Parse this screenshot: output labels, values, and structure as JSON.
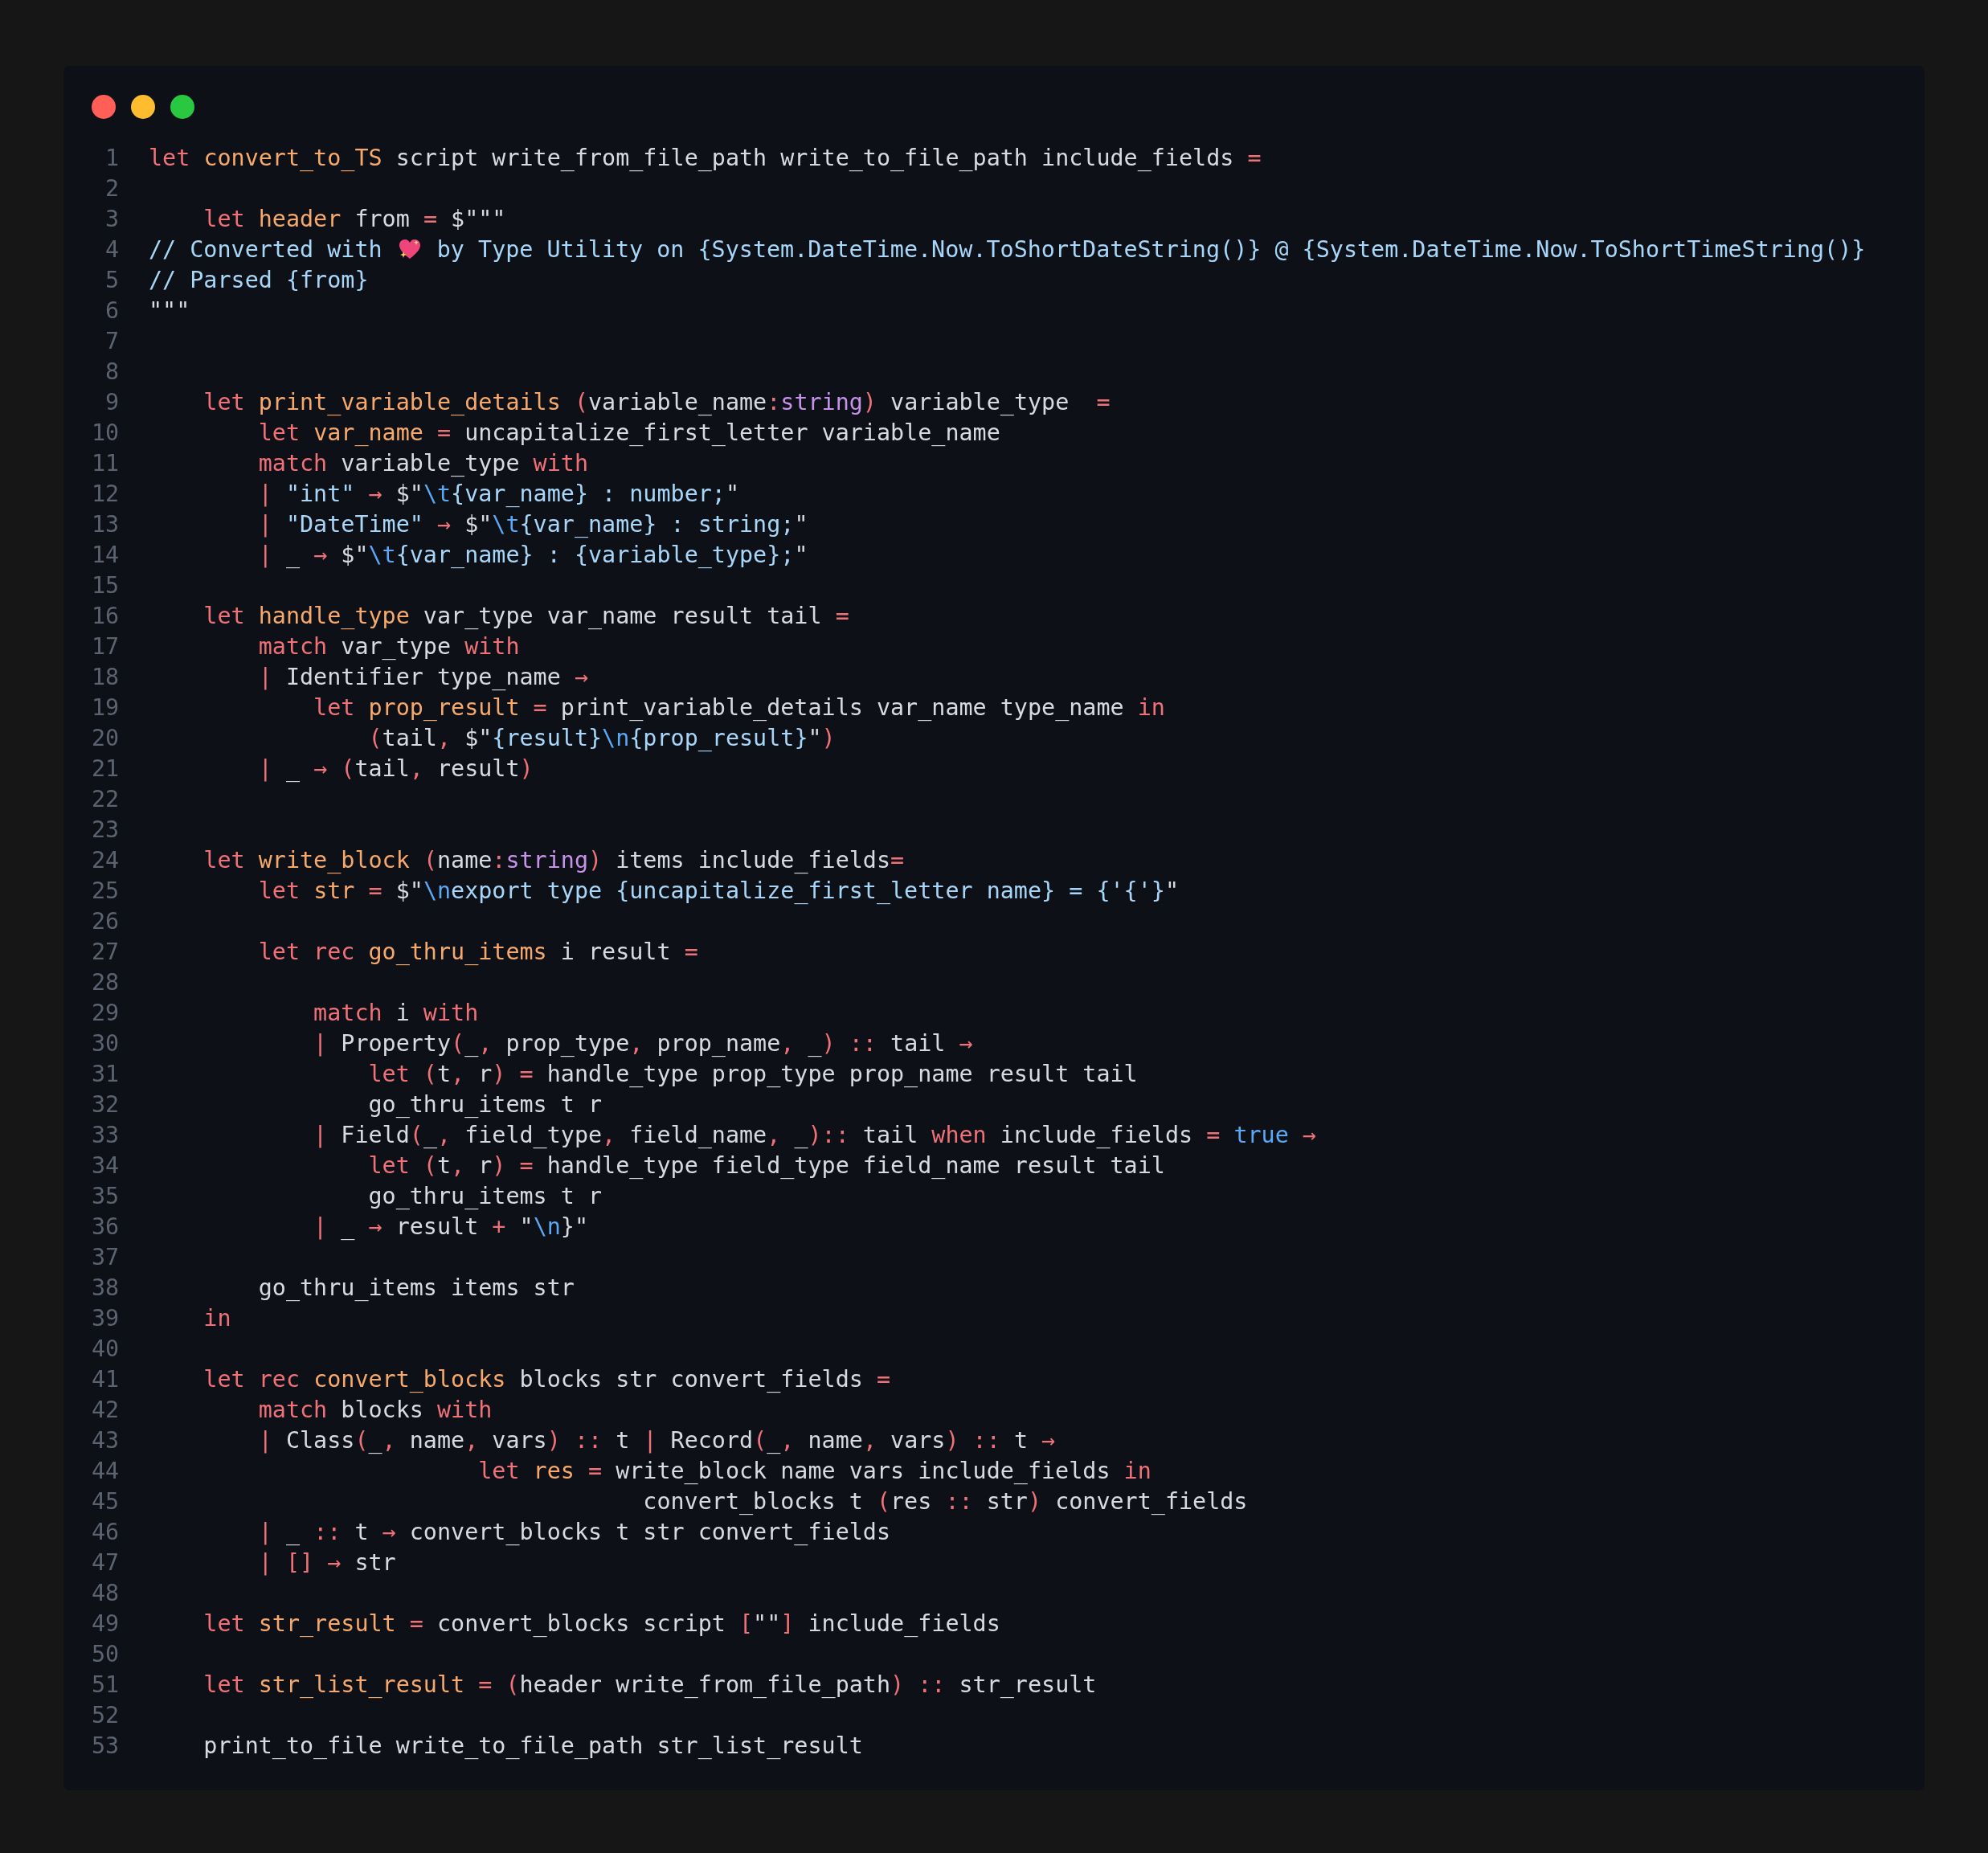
{
  "editor": {
    "lines": [
      {
        "number": "1",
        "tokens": [
          {
            "kind": "keyword",
            "text": "let "
          },
          {
            "kind": "name",
            "text": "convert_to_TS"
          },
          {
            "kind": "plain",
            "text": " script write_from_file_path write_to_file_path include_fields "
          },
          {
            "kind": "keyword",
            "text": "="
          }
        ]
      },
      {
        "number": "2"
      },
      {
        "number": "3",
        "tokens": [
          {
            "kind": "keyword",
            "text": "    let "
          },
          {
            "kind": "name",
            "text": "header"
          },
          {
            "kind": "plain",
            "text": " from "
          },
          {
            "kind": "keyword",
            "text": "="
          },
          {
            "kind": "plain",
            "text": " $\"\"\""
          }
        ]
      },
      {
        "number": "4",
        "tokens": [
          {
            "kind": "string",
            "text": "// Converted with "
          },
          {
            "kind": "heart"
          },
          {
            "kind": "string",
            "text": " by Type Utility on {System.DateTime.Now.ToShortDateString()} @ {System.DateTime.Now.ToShortTimeString()}"
          }
        ]
      },
      {
        "number": "5",
        "tokens": [
          {
            "kind": "string",
            "text": "// Parsed {from}"
          }
        ]
      },
      {
        "number": "6",
        "tokens": [
          {
            "kind": "plain",
            "text": "\"\"\""
          }
        ]
      },
      {
        "number": "7"
      },
      {
        "number": "8"
      },
      {
        "number": "9",
        "tokens": [
          {
            "kind": "keyword",
            "text": "    let "
          },
          {
            "kind": "name",
            "text": "print_variable_details "
          },
          {
            "kind": "keyword",
            "text": "("
          },
          {
            "kind": "plain",
            "text": "variable_name"
          },
          {
            "kind": "keyword",
            "text": ":"
          },
          {
            "kind": "type",
            "text": "string"
          },
          {
            "kind": "keyword",
            "text": ")"
          },
          {
            "kind": "plain",
            "text": " variable_type  "
          },
          {
            "kind": "keyword",
            "text": "="
          }
        ]
      },
      {
        "number": "10",
        "tokens": [
          {
            "kind": "keyword",
            "text": "        let "
          },
          {
            "kind": "name",
            "text": "var_name "
          },
          {
            "kind": "keyword",
            "text": "="
          },
          {
            "kind": "plain",
            "text": " uncapitalize_first_letter variable_name"
          }
        ]
      },
      {
        "number": "11",
        "tokens": [
          {
            "kind": "keyword",
            "text": "        match"
          },
          {
            "kind": "plain",
            "text": " variable_type "
          },
          {
            "kind": "keyword",
            "text": "with"
          }
        ]
      },
      {
        "number": "12",
        "tokens": [
          {
            "kind": "keyword",
            "text": "        | "
          },
          {
            "kind": "string",
            "text": "\"int\" "
          },
          {
            "kind": "keyword",
            "text": "→"
          },
          {
            "kind": "plain",
            "text": " $\""
          },
          {
            "kind": "constant",
            "text": "\\t"
          },
          {
            "kind": "string",
            "text": "{var_name} : number;"
          },
          {
            "kind": "plain",
            "text": "\""
          }
        ]
      },
      {
        "number": "13",
        "tokens": [
          {
            "kind": "keyword",
            "text": "        | "
          },
          {
            "kind": "string",
            "text": "\"DateTime\" "
          },
          {
            "kind": "keyword",
            "text": "→"
          },
          {
            "kind": "plain",
            "text": " $\""
          },
          {
            "kind": "constant",
            "text": "\\t"
          },
          {
            "kind": "string",
            "text": "{var_name} : string;"
          },
          {
            "kind": "plain",
            "text": "\""
          }
        ]
      },
      {
        "number": "14",
        "tokens": [
          {
            "kind": "keyword",
            "text": "        |"
          },
          {
            "kind": "plain",
            "text": " _ "
          },
          {
            "kind": "keyword",
            "text": "→"
          },
          {
            "kind": "plain",
            "text": " $\""
          },
          {
            "kind": "constant",
            "text": "\\t"
          },
          {
            "kind": "string",
            "text": "{var_name} : {variable_type};"
          },
          {
            "kind": "plain",
            "text": "\""
          }
        ]
      },
      {
        "number": "15"
      },
      {
        "number": "16",
        "tokens": [
          {
            "kind": "keyword",
            "text": "    let "
          },
          {
            "kind": "name",
            "text": "handle_type"
          },
          {
            "kind": "plain",
            "text": " var_type var_name result tail "
          },
          {
            "kind": "keyword",
            "text": "="
          }
        ]
      },
      {
        "number": "17",
        "tokens": [
          {
            "kind": "keyword",
            "text": "        match"
          },
          {
            "kind": "plain",
            "text": " var_type "
          },
          {
            "kind": "keyword",
            "text": "with"
          }
        ]
      },
      {
        "number": "18",
        "tokens": [
          {
            "kind": "keyword",
            "text": "        |"
          },
          {
            "kind": "plain",
            "text": " Identifier type_name "
          },
          {
            "kind": "keyword",
            "text": "→"
          }
        ]
      },
      {
        "number": "19",
        "tokens": [
          {
            "kind": "keyword",
            "text": "            let "
          },
          {
            "kind": "name",
            "text": "prop_result "
          },
          {
            "kind": "keyword",
            "text": "="
          },
          {
            "kind": "plain",
            "text": " print_variable_details var_name type_name "
          },
          {
            "kind": "keyword",
            "text": "in"
          }
        ]
      },
      {
        "number": "20",
        "tokens": [
          {
            "kind": "keyword",
            "text": "                ("
          },
          {
            "kind": "plain",
            "text": "tail"
          },
          {
            "kind": "keyword",
            "text": ","
          },
          {
            "kind": "plain",
            "text": " $\""
          },
          {
            "kind": "string",
            "text": "{result}"
          },
          {
            "kind": "constant",
            "text": "\\n"
          },
          {
            "kind": "string",
            "text": "{prop_result}"
          },
          {
            "kind": "plain",
            "text": "\""
          },
          {
            "kind": "keyword",
            "text": ")"
          }
        ]
      },
      {
        "number": "21",
        "tokens": [
          {
            "kind": "keyword",
            "text": "        |"
          },
          {
            "kind": "plain",
            "text": " _ "
          },
          {
            "kind": "keyword",
            "text": "→ ("
          },
          {
            "kind": "plain",
            "text": "tail"
          },
          {
            "kind": "keyword",
            "text": ","
          },
          {
            "kind": "plain",
            "text": " result"
          },
          {
            "kind": "keyword",
            "text": ")"
          }
        ]
      },
      {
        "number": "22"
      },
      {
        "number": "23"
      },
      {
        "number": "24",
        "tokens": [
          {
            "kind": "keyword",
            "text": "    let "
          },
          {
            "kind": "name",
            "text": "write_block "
          },
          {
            "kind": "keyword",
            "text": "("
          },
          {
            "kind": "plain",
            "text": "name"
          },
          {
            "kind": "keyword",
            "text": ":"
          },
          {
            "kind": "type",
            "text": "string"
          },
          {
            "kind": "keyword",
            "text": ")"
          },
          {
            "kind": "plain",
            "text": " items include_fields"
          },
          {
            "kind": "keyword",
            "text": "="
          }
        ]
      },
      {
        "number": "25",
        "tokens": [
          {
            "kind": "keyword",
            "text": "        let "
          },
          {
            "kind": "name",
            "text": "str "
          },
          {
            "kind": "keyword",
            "text": "="
          },
          {
            "kind": "plain",
            "text": " $\""
          },
          {
            "kind": "constant",
            "text": "\\n"
          },
          {
            "kind": "string",
            "text": "export type {uncapitalize_first_letter name} = {'{'}"
          },
          {
            "kind": "plain",
            "text": "\""
          }
        ]
      },
      {
        "number": "26"
      },
      {
        "number": "27",
        "tokens": [
          {
            "kind": "keyword",
            "text": "        let rec "
          },
          {
            "kind": "name",
            "text": "go_thru_items"
          },
          {
            "kind": "plain",
            "text": " i result "
          },
          {
            "kind": "keyword",
            "text": "="
          }
        ]
      },
      {
        "number": "28"
      },
      {
        "number": "29",
        "tokens": [
          {
            "kind": "keyword",
            "text": "            match"
          },
          {
            "kind": "plain",
            "text": " i "
          },
          {
            "kind": "keyword",
            "text": "with"
          }
        ]
      },
      {
        "number": "30",
        "tokens": [
          {
            "kind": "keyword",
            "text": "            |"
          },
          {
            "kind": "plain",
            "text": " Property"
          },
          {
            "kind": "keyword",
            "text": "("
          },
          {
            "kind": "plain",
            "text": "_"
          },
          {
            "kind": "keyword",
            "text": ","
          },
          {
            "kind": "plain",
            "text": " prop_type"
          },
          {
            "kind": "keyword",
            "text": ","
          },
          {
            "kind": "plain",
            "text": " prop_name"
          },
          {
            "kind": "keyword",
            "text": ","
          },
          {
            "kind": "plain",
            "text": " _"
          },
          {
            "kind": "keyword",
            "text": ") ::"
          },
          {
            "kind": "plain",
            "text": " tail "
          },
          {
            "kind": "keyword",
            "text": "→"
          }
        ]
      },
      {
        "number": "31",
        "tokens": [
          {
            "kind": "keyword",
            "text": "                let ("
          },
          {
            "kind": "plain",
            "text": "t"
          },
          {
            "kind": "keyword",
            "text": ","
          },
          {
            "kind": "plain",
            "text": " r"
          },
          {
            "kind": "keyword",
            "text": ") ="
          },
          {
            "kind": "plain",
            "text": " handle_type prop_type prop_name result tail"
          }
        ]
      },
      {
        "number": "32",
        "tokens": [
          {
            "kind": "plain",
            "text": "                go_thru_items t r"
          }
        ]
      },
      {
        "number": "33",
        "tokens": [
          {
            "kind": "keyword",
            "text": "            |"
          },
          {
            "kind": "plain",
            "text": " Field"
          },
          {
            "kind": "keyword",
            "text": "("
          },
          {
            "kind": "plain",
            "text": "_"
          },
          {
            "kind": "keyword",
            "text": ","
          },
          {
            "kind": "plain",
            "text": " field_type"
          },
          {
            "kind": "keyword",
            "text": ","
          },
          {
            "kind": "plain",
            "text": " field_name"
          },
          {
            "kind": "keyword",
            "text": ","
          },
          {
            "kind": "plain",
            "text": " _"
          },
          {
            "kind": "keyword",
            "text": ")::"
          },
          {
            "kind": "plain",
            "text": " tail "
          },
          {
            "kind": "keyword",
            "text": "when"
          },
          {
            "kind": "plain",
            "text": " include_fields "
          },
          {
            "kind": "keyword",
            "text": "= "
          },
          {
            "kind": "constant",
            "text": "true "
          },
          {
            "kind": "keyword",
            "text": "→"
          }
        ]
      },
      {
        "number": "34",
        "tokens": [
          {
            "kind": "keyword",
            "text": "                let ("
          },
          {
            "kind": "plain",
            "text": "t"
          },
          {
            "kind": "keyword",
            "text": ","
          },
          {
            "kind": "plain",
            "text": " r"
          },
          {
            "kind": "keyword",
            "text": ") ="
          },
          {
            "kind": "plain",
            "text": " handle_type field_type field_name result tail"
          }
        ]
      },
      {
        "number": "35",
        "tokens": [
          {
            "kind": "plain",
            "text": "                go_thru_items t r"
          }
        ]
      },
      {
        "number": "36",
        "tokens": [
          {
            "kind": "keyword",
            "text": "            |"
          },
          {
            "kind": "plain",
            "text": " _ "
          },
          {
            "kind": "keyword",
            "text": "→"
          },
          {
            "kind": "plain",
            "text": " result "
          },
          {
            "kind": "keyword",
            "text": "+"
          },
          {
            "kind": "plain",
            "text": " \""
          },
          {
            "kind": "constant",
            "text": "\\n"
          },
          {
            "kind": "plain",
            "text": "}\""
          }
        ]
      },
      {
        "number": "37"
      },
      {
        "number": "38",
        "tokens": [
          {
            "kind": "plain",
            "text": "        go_thru_items items str"
          }
        ]
      },
      {
        "number": "39",
        "tokens": [
          {
            "kind": "keyword",
            "text": "    in"
          }
        ]
      },
      {
        "number": "40"
      },
      {
        "number": "41",
        "tokens": [
          {
            "kind": "keyword",
            "text": "    let rec "
          },
          {
            "kind": "name",
            "text": "convert_blocks"
          },
          {
            "kind": "plain",
            "text": " blocks str convert_fields "
          },
          {
            "kind": "keyword",
            "text": "="
          }
        ]
      },
      {
        "number": "42",
        "tokens": [
          {
            "kind": "keyword",
            "text": "        match"
          },
          {
            "kind": "plain",
            "text": " blocks "
          },
          {
            "kind": "keyword",
            "text": "with"
          }
        ]
      },
      {
        "number": "43",
        "tokens": [
          {
            "kind": "keyword",
            "text": "        |"
          },
          {
            "kind": "plain",
            "text": " Class"
          },
          {
            "kind": "keyword",
            "text": "("
          },
          {
            "kind": "plain",
            "text": "_"
          },
          {
            "kind": "keyword",
            "text": ","
          },
          {
            "kind": "plain",
            "text": " name"
          },
          {
            "kind": "keyword",
            "text": ","
          },
          {
            "kind": "plain",
            "text": " vars"
          },
          {
            "kind": "keyword",
            "text": ") ::"
          },
          {
            "kind": "plain",
            "text": " t "
          },
          {
            "kind": "keyword",
            "text": "|"
          },
          {
            "kind": "plain",
            "text": " Record"
          },
          {
            "kind": "keyword",
            "text": "("
          },
          {
            "kind": "plain",
            "text": "_"
          },
          {
            "kind": "keyword",
            "text": ","
          },
          {
            "kind": "plain",
            "text": " name"
          },
          {
            "kind": "keyword",
            "text": ","
          },
          {
            "kind": "plain",
            "text": " vars"
          },
          {
            "kind": "keyword",
            "text": ") ::"
          },
          {
            "kind": "plain",
            "text": " t "
          },
          {
            "kind": "keyword",
            "text": "→"
          }
        ]
      },
      {
        "number": "44",
        "tokens": [
          {
            "kind": "keyword",
            "text": "                        let "
          },
          {
            "kind": "name",
            "text": "res "
          },
          {
            "kind": "keyword",
            "text": "="
          },
          {
            "kind": "plain",
            "text": " write_block name vars include_fields "
          },
          {
            "kind": "keyword",
            "text": "in"
          }
        ]
      },
      {
        "number": "45",
        "tokens": [
          {
            "kind": "plain",
            "text": "                                    convert_blocks t "
          },
          {
            "kind": "keyword",
            "text": "("
          },
          {
            "kind": "plain",
            "text": "res "
          },
          {
            "kind": "keyword",
            "text": "::"
          },
          {
            "kind": "plain",
            "text": " str"
          },
          {
            "kind": "keyword",
            "text": ")"
          },
          {
            "kind": "plain",
            "text": " convert_fields"
          }
        ]
      },
      {
        "number": "46",
        "tokens": [
          {
            "kind": "keyword",
            "text": "        |"
          },
          {
            "kind": "plain",
            "text": " _ "
          },
          {
            "kind": "keyword",
            "text": "::"
          },
          {
            "kind": "plain",
            "text": " t "
          },
          {
            "kind": "keyword",
            "text": "→"
          },
          {
            "kind": "plain",
            "text": " convert_blocks t str convert_fields"
          }
        ]
      },
      {
        "number": "47",
        "tokens": [
          {
            "kind": "keyword",
            "text": "        | [] →"
          },
          {
            "kind": "plain",
            "text": " str"
          }
        ]
      },
      {
        "number": "48"
      },
      {
        "number": "49",
        "tokens": [
          {
            "kind": "keyword",
            "text": "    let "
          },
          {
            "kind": "name",
            "text": "str_result "
          },
          {
            "kind": "keyword",
            "text": "="
          },
          {
            "kind": "plain",
            "text": " convert_blocks script "
          },
          {
            "kind": "keyword",
            "text": "["
          },
          {
            "kind": "plain",
            "text": "\"\""
          },
          {
            "kind": "keyword",
            "text": "]"
          },
          {
            "kind": "plain",
            "text": " include_fields"
          }
        ]
      },
      {
        "number": "50"
      },
      {
        "number": "51",
        "tokens": [
          {
            "kind": "keyword",
            "text": "    let "
          },
          {
            "kind": "name",
            "text": "str_list_result "
          },
          {
            "kind": "keyword",
            "text": "= ("
          },
          {
            "kind": "plain",
            "text": "header write_from_file_path"
          },
          {
            "kind": "keyword",
            "text": ") ::"
          },
          {
            "kind": "plain",
            "text": " str_result"
          }
        ]
      },
      {
        "number": "52"
      },
      {
        "number": "53",
        "tokens": [
          {
            "kind": "plain",
            "text": "    print_to_file write_to_file_path str_list_result"
          }
        ]
      }
    ]
  }
}
